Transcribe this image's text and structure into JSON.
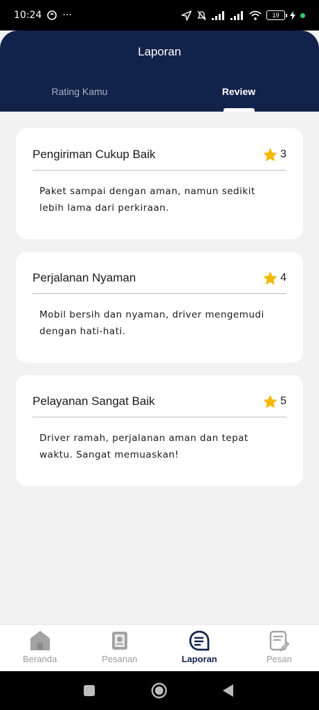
{
  "status_bar": {
    "time": "10:24",
    "battery": "19",
    "overflow": "···"
  },
  "header": {
    "title": "Laporan",
    "tabs": [
      {
        "label": "Rating Kamu",
        "active": false
      },
      {
        "label": "Review",
        "active": true
      }
    ]
  },
  "reviews": [
    {
      "title": "Pengiriman Cukup Baik",
      "rating": "3",
      "body": "Paket sampai dengan aman, namun sedikit lebih lama dari perkiraan."
    },
    {
      "title": "Perjalanan Nyaman",
      "rating": "4",
      "body": "Mobil bersih dan nyaman, driver mengemudi dengan hati-hati."
    },
    {
      "title": "Pelayanan Sangat Baik",
      "rating": "5",
      "body": "Driver ramah, perjalanan aman dan tepat waktu. Sangat memuaskan!"
    }
  ],
  "bottom_nav": [
    {
      "label": "Beranda",
      "icon": "home-icon",
      "active": false
    },
    {
      "label": "Pesanan",
      "icon": "orders-icon",
      "active": false
    },
    {
      "label": "Laporan",
      "icon": "report-icon",
      "active": true
    },
    {
      "label": "Pesan",
      "icon": "message-icon",
      "active": false
    }
  ],
  "colors": {
    "header_bg": "#12234b",
    "star": "#f5b800",
    "page_bg": "#f2f2f2",
    "inactive": "#9a9a9a"
  }
}
